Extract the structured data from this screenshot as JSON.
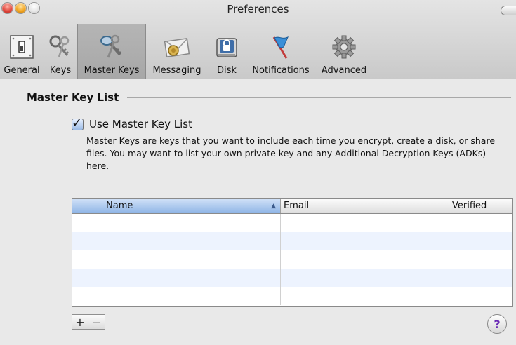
{
  "window": {
    "title": "Preferences"
  },
  "toolbar": {
    "items": [
      {
        "label": "General",
        "icon": "general-switch-icon"
      },
      {
        "label": "Keys",
        "icon": "keys-icon"
      },
      {
        "label": "Master Keys",
        "icon": "master-keys-icon",
        "selected": true
      },
      {
        "label": "Messaging",
        "icon": "envelope-icon"
      },
      {
        "label": "Disk",
        "icon": "disk-lock-icon"
      },
      {
        "label": "Notifications",
        "icon": "flag-icon"
      },
      {
        "label": "Advanced",
        "icon": "gear-icon"
      }
    ]
  },
  "section": {
    "title": "Master Key List"
  },
  "checkbox": {
    "label": "Use Master Key List",
    "checked": true
  },
  "description": "Master Keys are keys that you want to include each time you encrypt, create a disk, or share files. You may want to list your own private key and any Additional Decryption Keys (ADKs) here.",
  "table": {
    "columns": [
      "Name",
      "Email",
      "Verified"
    ],
    "sorted_column": "Name",
    "rows": []
  },
  "buttons": {
    "add": "+",
    "remove": "−",
    "help": "?"
  },
  "colors": {
    "selection": "#8fb5e6",
    "alt_row": "#edf3fe"
  }
}
